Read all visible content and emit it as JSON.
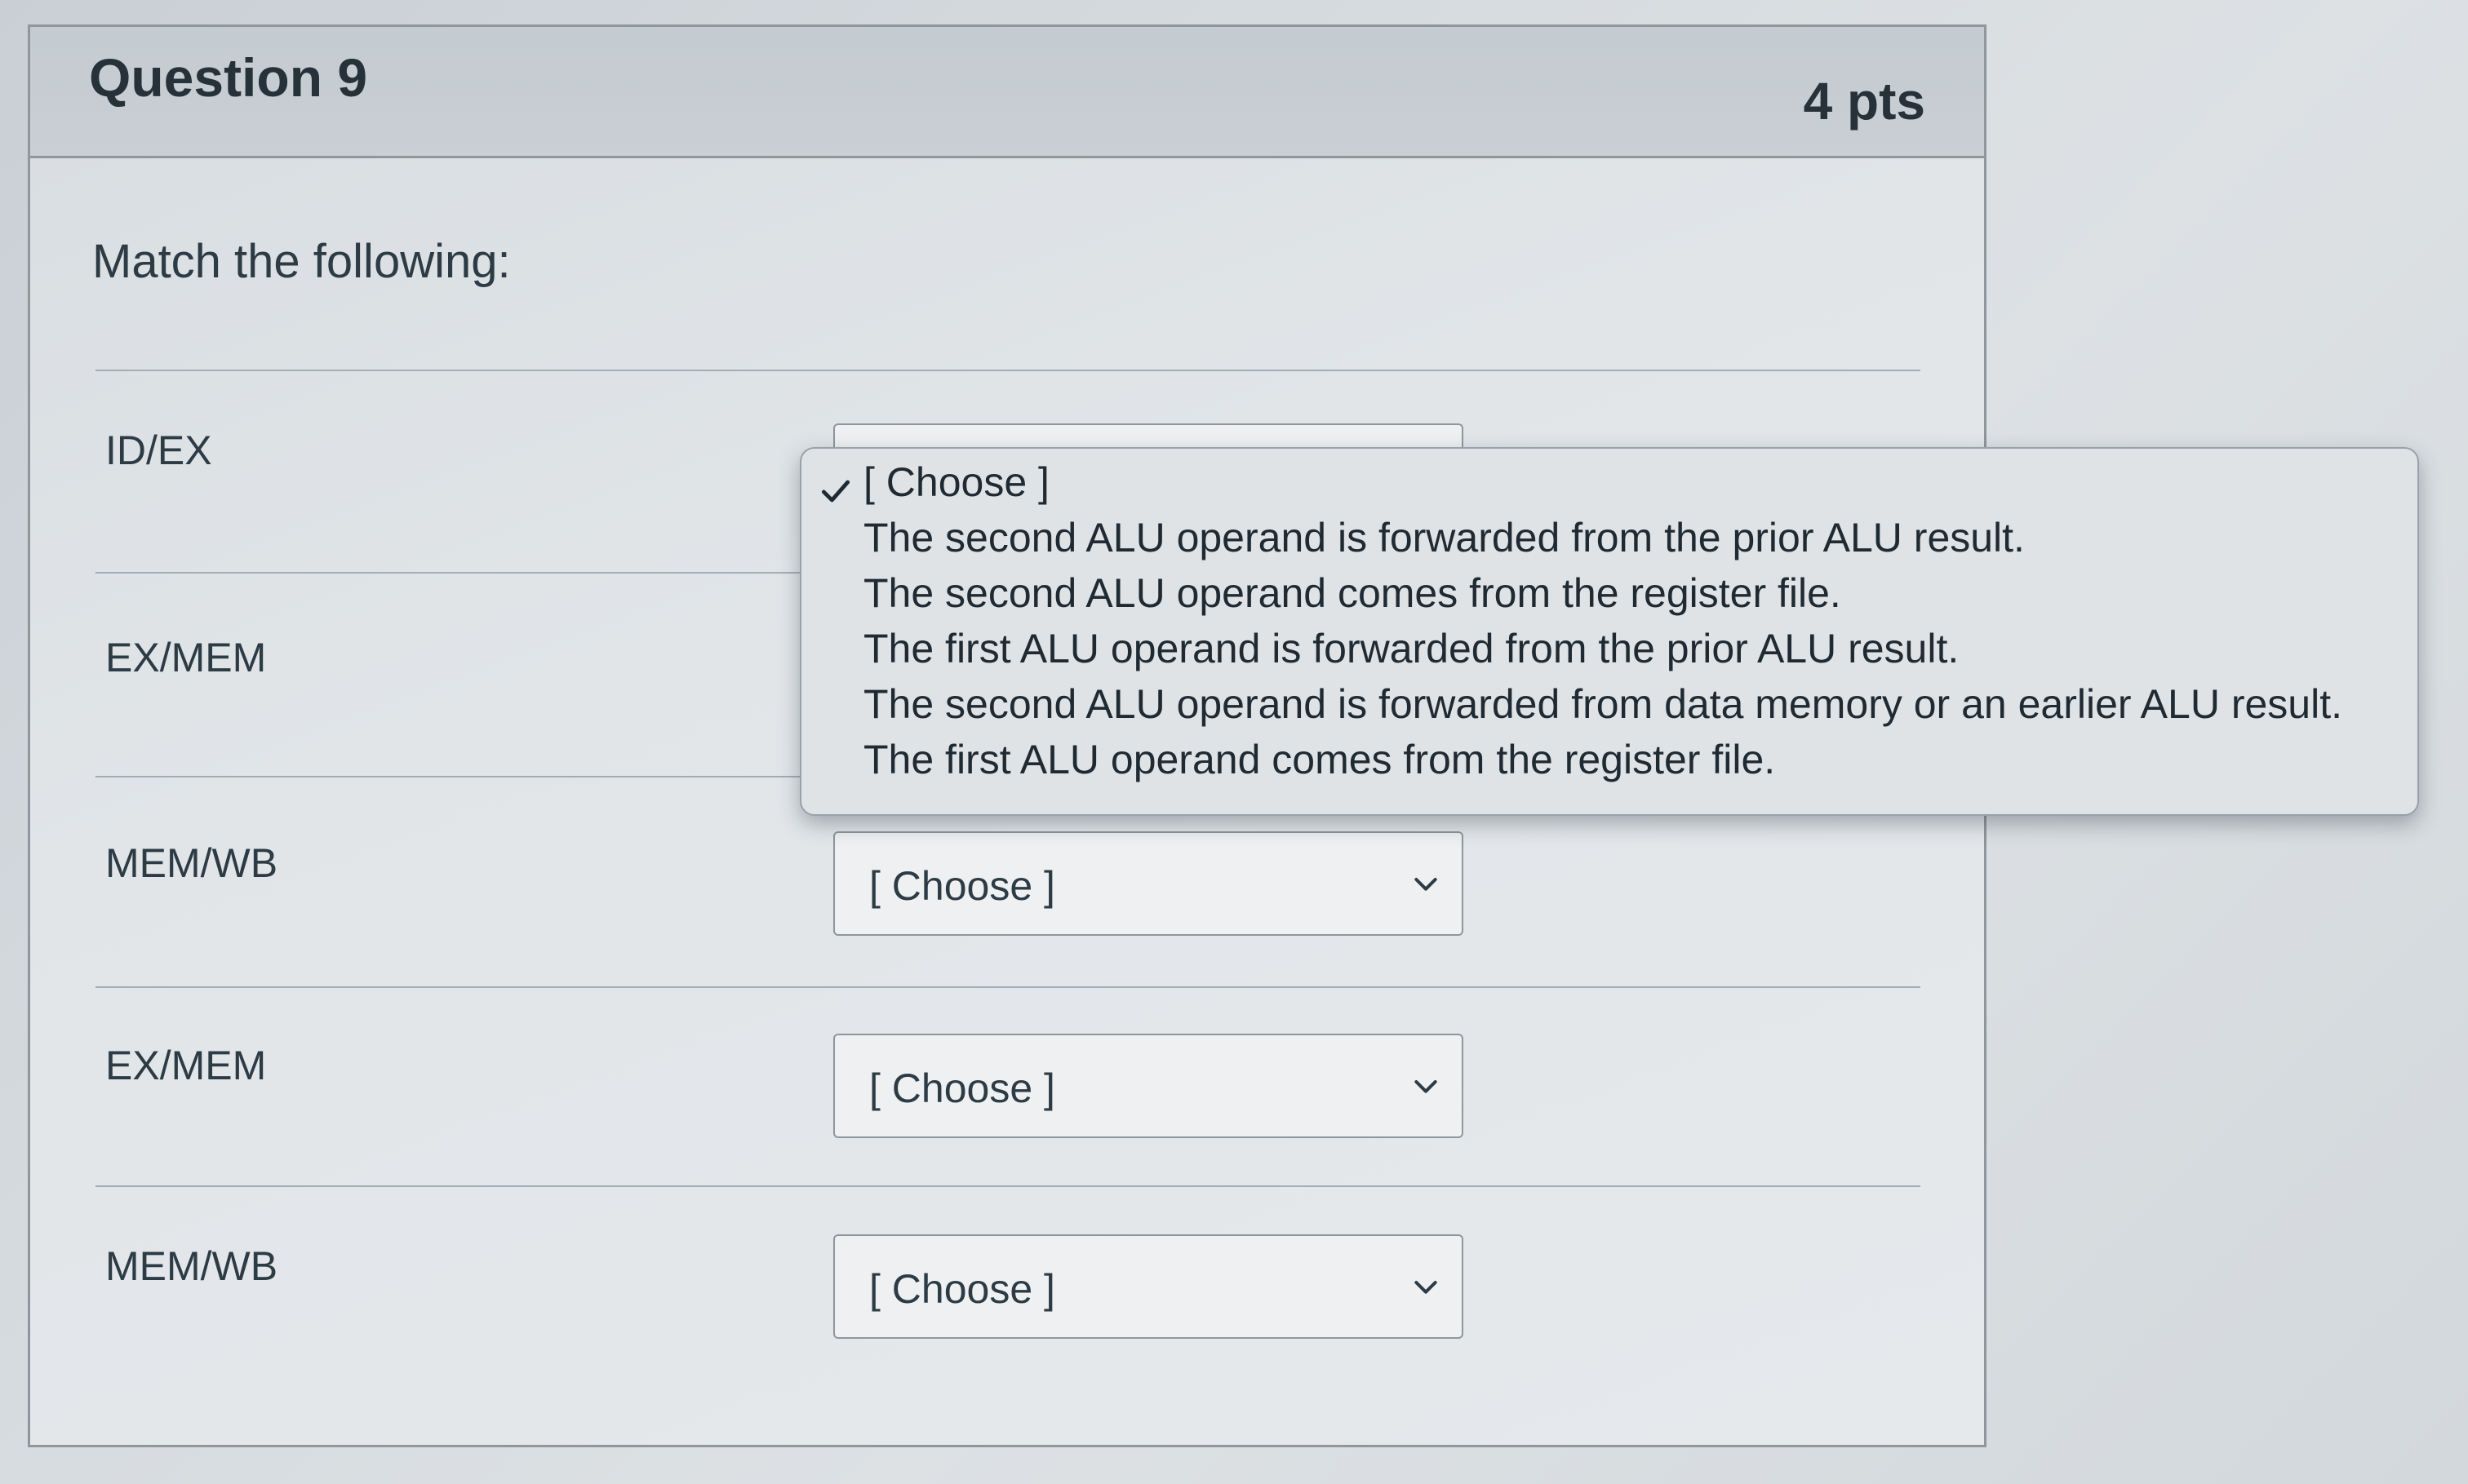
{
  "question": {
    "title": "Question 9",
    "points": "4 pts",
    "prompt": "Match the following:"
  },
  "rows": [
    {
      "label": "ID/EX",
      "selected": "[ Choose ]",
      "open": true
    },
    {
      "label": "EX/MEM",
      "selected": "[ Choose ]"
    },
    {
      "label": "MEM/WB",
      "selected": "[ Choose ]"
    },
    {
      "label": "EX/MEM",
      "selected": "[ Choose ]"
    },
    {
      "label": "MEM/WB",
      "selected": "[ Choose ]"
    }
  ],
  "dropdown": {
    "checked_icon": "check-icon",
    "options": [
      "[ Choose ]",
      "The second ALU operand is forwarded from the prior ALU result.",
      "The second ALU operand comes from the register file.",
      "The first ALU operand is forwarded from the prior ALU result.",
      "The second ALU operand is forwarded from data memory or an earlier ALU result.",
      "The first ALU operand comes from the register file."
    ]
  },
  "icons": {
    "chevron": "chevron-down-icon",
    "check": "check-icon"
  }
}
